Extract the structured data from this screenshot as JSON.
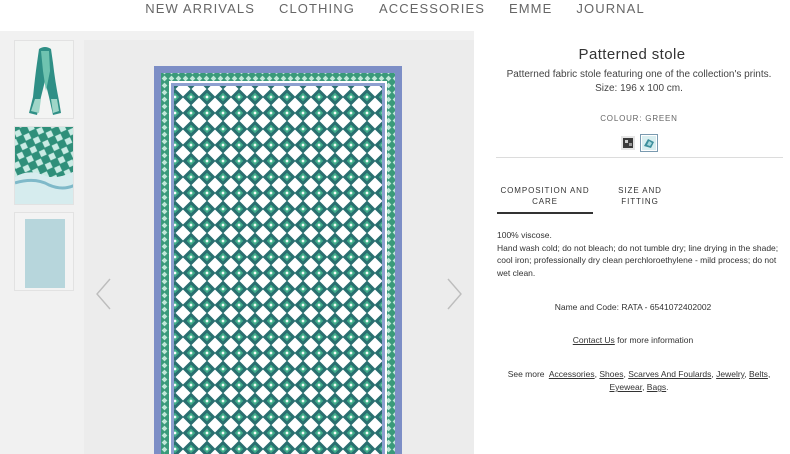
{
  "nav": {
    "items": [
      "NEW ARRIVALS",
      "CLOTHING",
      "ACCESSORIES",
      "EMME",
      "JOURNAL"
    ]
  },
  "gallery": {
    "thumbnails": [
      "thumbnail-scarf-on-mannequin",
      "thumbnail-scarf-detail",
      "thumbnail-scarf-flat-light"
    ],
    "prev_icon": "chevron-left-icon",
    "next_icon": "chevron-right-icon",
    "colors": {
      "border_blue": "#7d8ec6",
      "green": "#3a9a7a",
      "teal_dark": "#2a6f70",
      "white": "#ffffff",
      "background": "#f1f1f1"
    }
  },
  "product": {
    "title": "Patterned stole",
    "description": "Patterned fabric stole featuring one of the collection's prints.",
    "size": "Size: 196 x 100 cm.",
    "colour_label": "COLOUR: GREEN",
    "swatches": [
      "swatch-dark",
      "swatch-green"
    ]
  },
  "tabs": {
    "composition_line1": "COMPOSITION AND",
    "composition_line2": "CARE",
    "size_fitting": "SIZE AND FITTING"
  },
  "care": {
    "composition": "100% viscose.",
    "instructions": "Hand wash cold; do not bleach; do not tumble dry; line drying in the shade; cool iron; professionally dry clean perchloroethylene - mild process; do not wet clean."
  },
  "code": {
    "text": "Name and Code: RATA - 6541072402002"
  },
  "contact": {
    "link": "Contact Us",
    "suffix": " for more information"
  },
  "see_more": {
    "prefix": "See more",
    "links": [
      "Accessories",
      "Shoes",
      "Scarves And Foulards",
      "Jewelry",
      "Belts",
      "Eyewear",
      "Bags"
    ]
  }
}
